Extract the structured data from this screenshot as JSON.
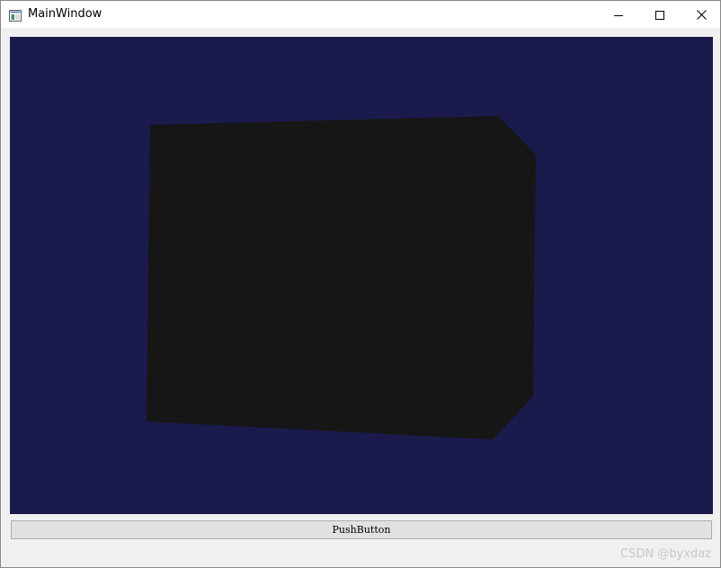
{
  "window": {
    "title": "MainWindow",
    "controls": {
      "minimize": "minimize-icon",
      "maximize": "maximize-icon",
      "close": "close-icon"
    }
  },
  "viewport": {
    "background_color": "#1b1a4d",
    "object_color": "#161616"
  },
  "button": {
    "label": "PushButton"
  },
  "watermark": {
    "text": "CSDN @byxdaz"
  }
}
